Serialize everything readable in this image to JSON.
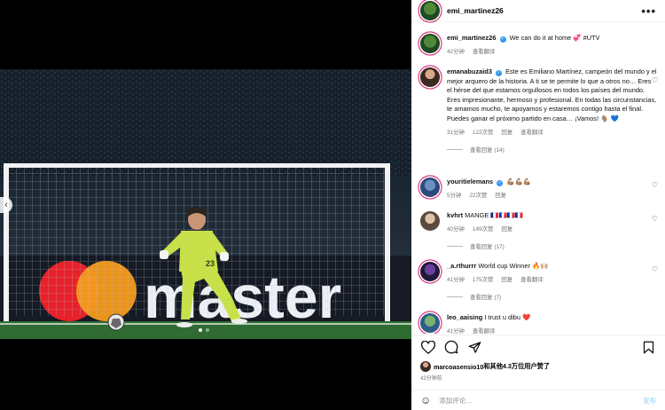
{
  "media": {
    "nav_prev_icon": "chevron-left-icon",
    "slides": 2,
    "active_slide": 1,
    "photo_texts": {
      "sponsor": "master",
      "shirt_number": "23"
    }
  },
  "header": {
    "username": "emi_martinez26",
    "more": "•••"
  },
  "caption": {
    "username": "emi_martinez26",
    "text": "We can do it at home 💞 #UTV",
    "time": "42分钟",
    "translate": "查看翻译"
  },
  "comments": [
    {
      "username": "emanabuzaid3",
      "verified": true,
      "text": "Este es Emiliano Martínez, campeón del mundo y el mejor arquero de la historia. A ti se te permite lo que a otros no… Eres el héroe del que estamos orgullosos en todos los países del mundo. Eres impresionante, hermoso y profesional. En todas las circunstancias, te amamos mucho, te apoyamos y estaremos contigo hasta el final. Puedes ganar el próximo partido en casa… ¡Vamos! 🐐 💙",
      "time": "31分钟",
      "likes": "122次赞",
      "reply": "回复",
      "translate": "查看翻译",
      "view_replies": "查看回复 (14)"
    },
    {
      "username": "youritielemans",
      "verified": true,
      "text": "💪🏽💪🏽💪🏽",
      "time": "5分钟",
      "likes": "22次赞",
      "reply": "回复"
    },
    {
      "username": "kvhrt",
      "verified": false,
      "text": "MANGE 🇫🇷🇫🇷🇫🇷🇫🇷",
      "time": "40分钟",
      "likes": "149次赞",
      "reply": "回复",
      "view_replies": "查看回复 (17)"
    },
    {
      "username": "_a.rthurrr",
      "verified": false,
      "text": "World cup Winner 🔥🙌🏼",
      "time": "41分钟",
      "likes": "175次赞",
      "reply": "回复",
      "translate": "查看翻译",
      "view_replies": "查看回复 (7)"
    },
    {
      "username": "leo_aaising",
      "verified": false,
      "text": "I trust u dibu ❤️",
      "time": "41分钟",
      "translate": "查看翻译"
    }
  ],
  "actions": {
    "like_icon": "heart-icon",
    "comment_icon": "comment-icon",
    "share_icon": "share-icon",
    "save_icon": "bookmark-icon"
  },
  "likes_line": {
    "user": "marcoasensio10",
    "rest": "和其他4.3万位用户赞了",
    "time": "42分钟前"
  },
  "add_comment": {
    "placeholder": "添加评论…",
    "post_label": "发布"
  },
  "colors": {
    "verified": "#3897f0",
    "story_ring": "#d62976",
    "keeper_kit": "#c8e04a",
    "pitch": "#2f6b33"
  }
}
